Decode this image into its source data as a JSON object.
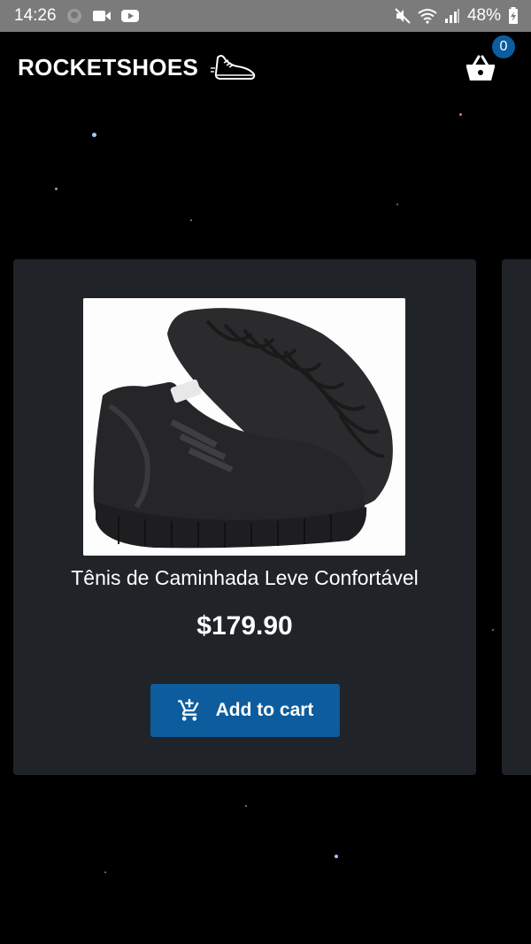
{
  "status_bar": {
    "time": "14:26",
    "battery": "48%"
  },
  "header": {
    "logo": "ROCKETSHOES",
    "cart_count": "0"
  },
  "product": {
    "title": "Tênis de Caminhada Leve Confortável",
    "price": "$179.90",
    "add_to_cart_label": "Add to cart"
  },
  "colors": {
    "background": "#000000",
    "card": "#202328",
    "accent": "#0c5c9e"
  }
}
